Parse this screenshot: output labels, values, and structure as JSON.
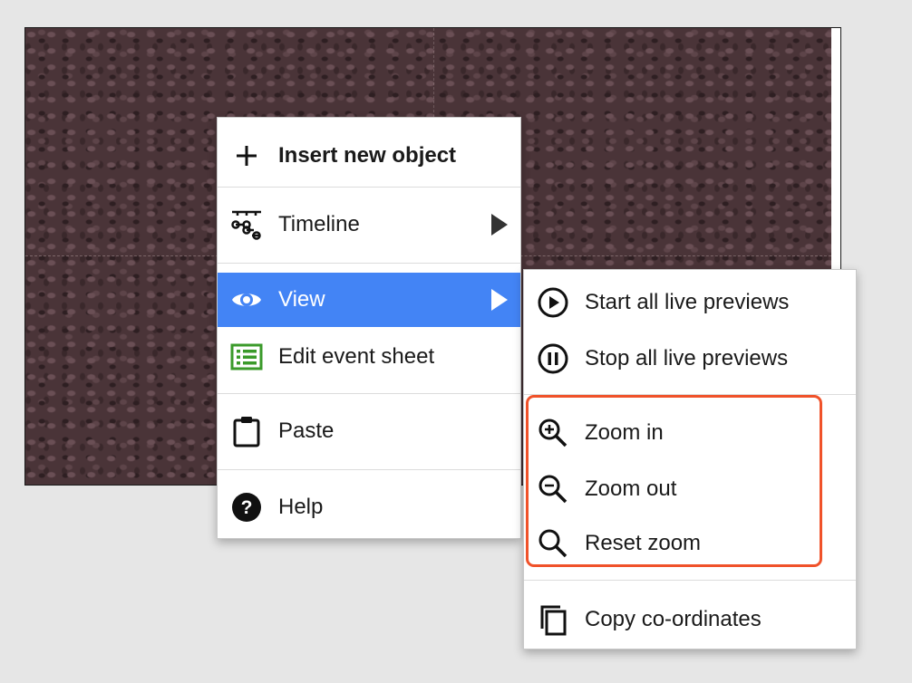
{
  "main_menu": {
    "items": [
      {
        "label": "Insert new object",
        "icon": "plus-icon"
      },
      {
        "label": "Timeline",
        "icon": "timeline-icon"
      },
      {
        "label": "View",
        "icon": "eye-icon"
      },
      {
        "label": "Edit event sheet",
        "icon": "event-sheet-icon"
      },
      {
        "label": "Paste",
        "icon": "clipboard-icon"
      },
      {
        "label": "Help",
        "icon": "help-icon"
      }
    ]
  },
  "view_submenu": {
    "items": [
      {
        "label": "Start all live previews",
        "icon": "play-circle-icon"
      },
      {
        "label": "Stop all live previews",
        "icon": "pause-circle-icon"
      },
      {
        "label": "Zoom in",
        "icon": "zoom-in-icon"
      },
      {
        "label": "Zoom out",
        "icon": "zoom-out-icon"
      },
      {
        "label": "Reset zoom",
        "icon": "search-icon"
      },
      {
        "label": "Copy co-ordinates",
        "icon": "copy-icon"
      }
    ]
  },
  "colors": {
    "active_item": "#4384f5",
    "highlight_border": "#f0522a",
    "event_sheet_icon": "#3a9a2a"
  }
}
